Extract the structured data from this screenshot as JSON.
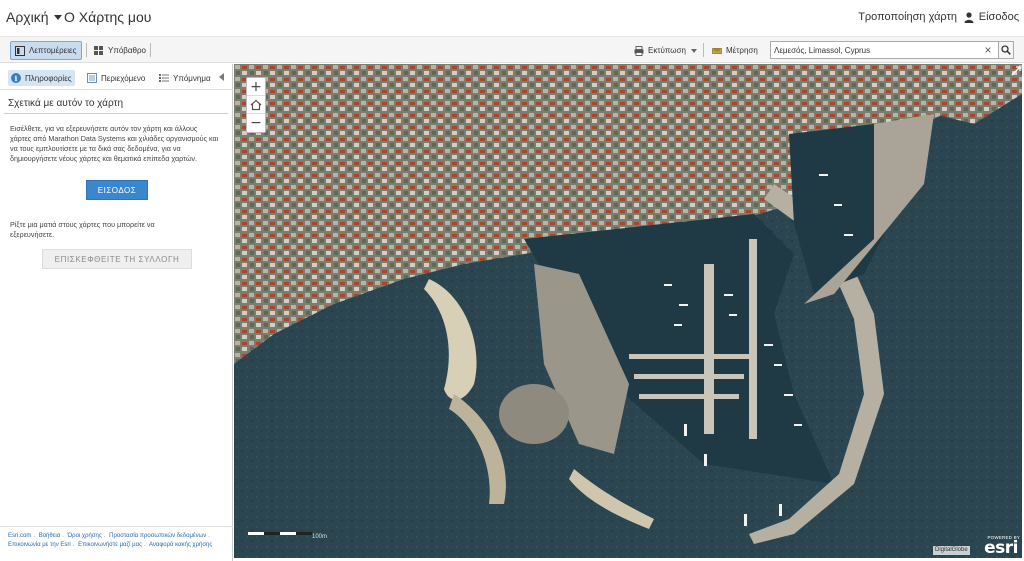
{
  "header": {
    "home_label": "Αρχική",
    "map_title": "Ο Χάρτης μου",
    "modify_map": "Τροποποίηση χάρτη",
    "sign_in": "Είσοδος"
  },
  "toolbar": {
    "details": "Λεπτομέρειες",
    "basemap": "Υπόβαθρο",
    "print": "Εκτύπωση",
    "measure": "Μέτρηση",
    "search_value": "Λεμεσός, Limassol, Cyprus"
  },
  "side": {
    "tabs": [
      {
        "label": "Πληροφορίες"
      },
      {
        "label": "Περιεχόμενο"
      },
      {
        "label": "Υπόμνημα"
      }
    ],
    "about_title": "Σχετικά με αυτόν το χάρτη",
    "about_text": "Εισέλθετε, για να εξερευνήσετε αυτόν τον χάρτη και άλλους χάρτες από Marathon Data Systems και χιλιάδες οργανισμούς και να τους εμπλουτίσετε με τα δικά σας δεδομένα, για να δημιουργήσετε νέους χάρτες και θεματικά επίπεδα χαρτών.",
    "signin_button": "ΕΙΣΟΔΟΣ",
    "gallery_text": "Ρίξτε μια ματιά στους χάρτες που μπορείτε να εξερευνήσετε.",
    "gallery_button": "ΕΠΙΣΚΕΦΘΕΙΤΕ ΤΗ ΣΥΛΛΟΓΗ",
    "footer_links": [
      "Esri.com",
      "Βοήθεια",
      "Όροι χρήσης",
      "Προστασία προσωπικών δεδομένων",
      "Επικοινωνία με την Esri",
      "Επικοινωνήστε μαζί μας",
      "Αναφορά κακής χρήσης"
    ]
  },
  "map": {
    "zoom_in": "+",
    "zoom_out": "−",
    "scale_label": "100m",
    "attribution": "DigitalGlobe",
    "esri_powered": "POWERED BY",
    "esri_word": "esri"
  },
  "colors": {
    "accent": "#3b87cf",
    "sea": "#24404a",
    "land": "#7a7a6c"
  }
}
